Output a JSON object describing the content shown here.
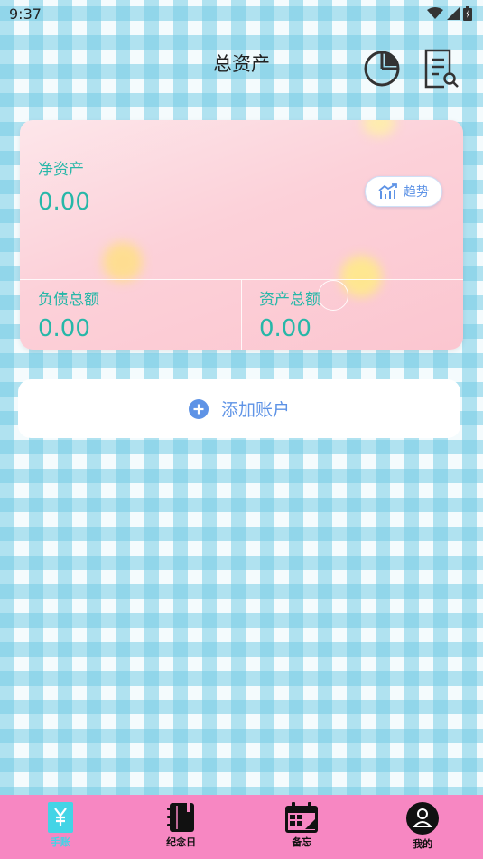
{
  "status_bar": {
    "time": "9:37",
    "icons": [
      "wifi-icon",
      "signal-icon",
      "battery-icon"
    ]
  },
  "header": {
    "title": "总资产",
    "icons": [
      "pie-chart-icon",
      "search-document-icon"
    ]
  },
  "summary_card": {
    "net_assets_label": "净资产",
    "net_assets_value": "0.00",
    "trend_button_label": "趋势",
    "liabilities_label": "负债总额",
    "liabilities_value": "0.00",
    "total_assets_label": "资产总额",
    "total_assets_value": "0.00"
  },
  "add_account": {
    "label": "添加账户"
  },
  "tabbar": {
    "active": 0,
    "items": [
      {
        "label": "手账",
        "icon": "yen-icon"
      },
      {
        "label": "纪念日",
        "icon": "notebook-icon"
      },
      {
        "label": "备忘",
        "icon": "calendar-icon"
      },
      {
        "label": "我的",
        "icon": "profile-icon"
      }
    ]
  },
  "colors": {
    "accent_teal": "#27b7a8",
    "accent_blue": "#5e93e6",
    "tabbar_pink": "#f787c2",
    "active_tab": "#43d4e6"
  }
}
